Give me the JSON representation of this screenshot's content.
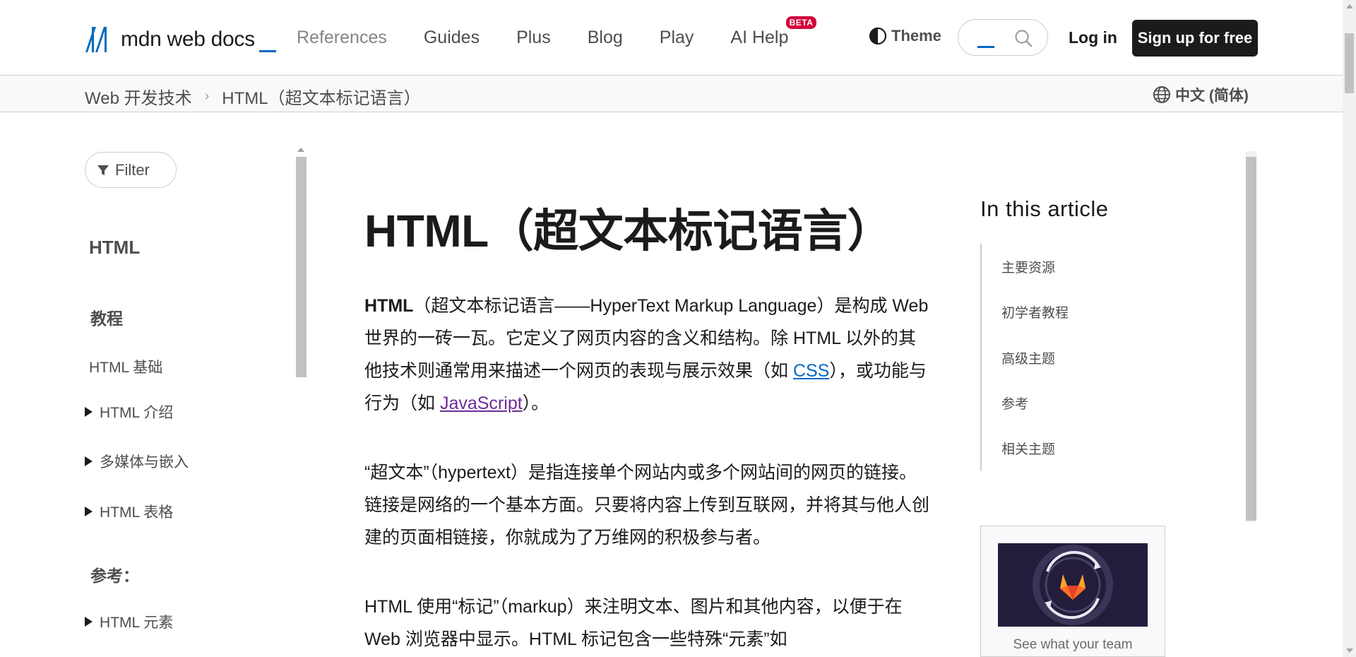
{
  "header": {
    "logo_text": "mdn web docs",
    "nav": [
      "References",
      "Guides",
      "Plus",
      "Blog",
      "Play",
      "AI Help"
    ],
    "beta_badge": "BETA",
    "theme_label": "Theme",
    "search_placeholder": "",
    "login_label": "Log in",
    "signup_label": "Sign up for free"
  },
  "breadcrumb": {
    "items": [
      "Web 开发技术",
      "HTML（超文本标记语言）"
    ],
    "separator": "›",
    "language": "中文 (简体)"
  },
  "sidebar": {
    "filter_label": "Filter",
    "title": "HTML",
    "tutorial_heading": "教程",
    "basics": "HTML 基础",
    "intro": "HTML 介绍",
    "multimedia": "多媒体与嵌入",
    "tables": "HTML 表格",
    "reference_heading": "参考：",
    "elements": "HTML 元素"
  },
  "article": {
    "title": "HTML（超文本标记语言）",
    "p1_bold": "HTML",
    "p1_a": "（超文本标记语言——HyperText Markup Language）是构成 Web 世界的一砖一瓦。它定义了网页内容的含义和结构。除 HTML 以外的其他技术则通常用来描述一个网页的表现与展示效果（如 ",
    "p1_link1": "CSS",
    "p1_b": "），或功能与行为（如 ",
    "p1_link2": "JavaScript",
    "p1_c": "）。",
    "p2": "“超文本”（hypertext）是指连接单个网站内或多个网站间的网页的链接。链接是网络的一个基本方面。只要将内容上传到互联网，并将其与他人创建的页面相链接，你就成为了万维网的积极参与者。",
    "p3": "HTML 使用“标记”（markup）来注明文本、图片和其他内容，以便于在 Web 浏览器中显示。HTML 标记包含一些特殊“元素”如"
  },
  "toc": {
    "title": "In this article",
    "items": [
      "主要资源",
      "初学者教程",
      "高级主题",
      "参考",
      "相关主题"
    ]
  },
  "ad": {
    "text": "See what your team"
  },
  "colors": {
    "accent": "#0069c2",
    "visited": "#6e2c96",
    "signup_bg": "#1b1b1b",
    "beta": "#d30038"
  }
}
